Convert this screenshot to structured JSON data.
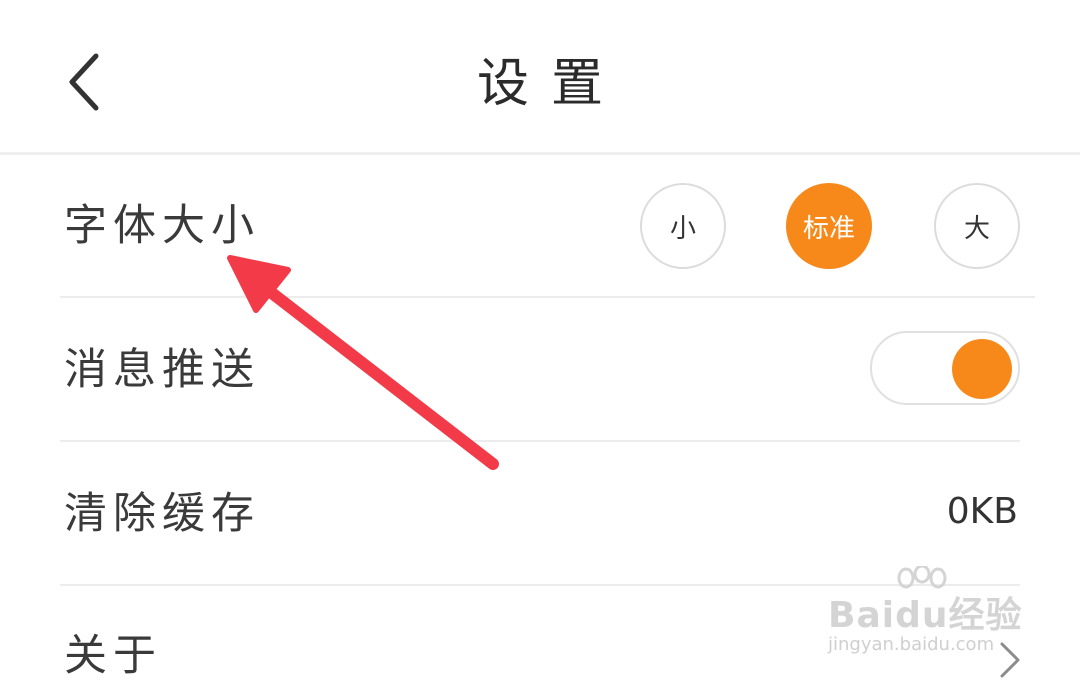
{
  "header": {
    "title": "设置",
    "back_icon": "chevron-left-icon"
  },
  "settings": {
    "font_size": {
      "label": "字体大小",
      "options": [
        "小",
        "标准",
        "大"
      ],
      "selected": "标准"
    },
    "push": {
      "label": "消息推送",
      "enabled": true
    },
    "cache": {
      "label": "清除缓存",
      "value": "0KB"
    },
    "about": {
      "label": "关于",
      "icon": "chevron-right-icon"
    }
  },
  "annotation": {
    "arrow_color": "#f23a48"
  },
  "colors": {
    "accent": "#f7891a",
    "divider": "#ececec",
    "text": "#333333"
  },
  "watermark": {
    "brand": "Baidu经验",
    "url": "jingyan.baidu.com"
  }
}
